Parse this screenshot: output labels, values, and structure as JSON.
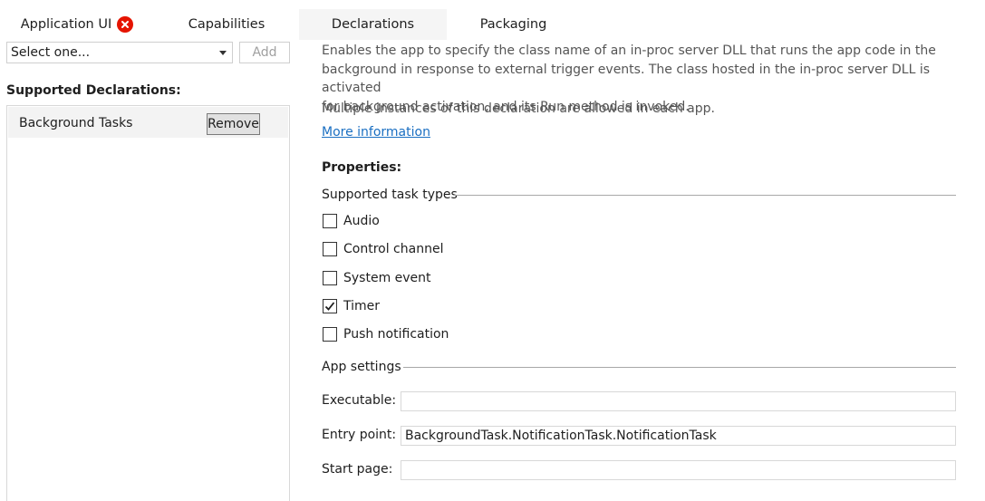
{
  "tabs": [
    {
      "label": "Application UI",
      "has_error": true
    },
    {
      "label": "Capabilities"
    },
    {
      "label": "Declarations",
      "active": true
    },
    {
      "label": "Packaging"
    }
  ],
  "left": {
    "select_value": "Select one...",
    "add_label": "Add",
    "supported_heading": "Supported Declarations:",
    "items": [
      {
        "label": "Background Tasks",
        "remove_label": "Remove"
      }
    ]
  },
  "right": {
    "description_lines": [
      "Enables the app to specify the class name of an in-proc server DLL that runs the app code in the",
      "background in response to external trigger events. The class hosted in the in-proc server DLL is activated",
      "for background activation, and its Run method is invoked."
    ],
    "multiple_instances": "Multiple instances of this declaration are allowed in each app.",
    "more_info": "More information",
    "properties_heading": "Properties:",
    "task_types_title": "Supported task types",
    "task_types": [
      {
        "label": "Audio",
        "checked": false
      },
      {
        "label": "Control channel",
        "checked": false
      },
      {
        "label": "System event",
        "checked": false
      },
      {
        "label": "Timer",
        "checked": true
      },
      {
        "label": "Push notification",
        "checked": false
      }
    ],
    "app_settings_title": "App settings",
    "fields": [
      {
        "label": "Executable:",
        "value": ""
      },
      {
        "label": "Entry point:",
        "value": "BackgroundTask.NotificationTask.NotificationTask"
      },
      {
        "label": "Start page:",
        "value": ""
      }
    ]
  },
  "colors": {
    "error": "#e51400",
    "link": "#1a6fc2",
    "active_tab_bg": "#f5f5f5"
  }
}
